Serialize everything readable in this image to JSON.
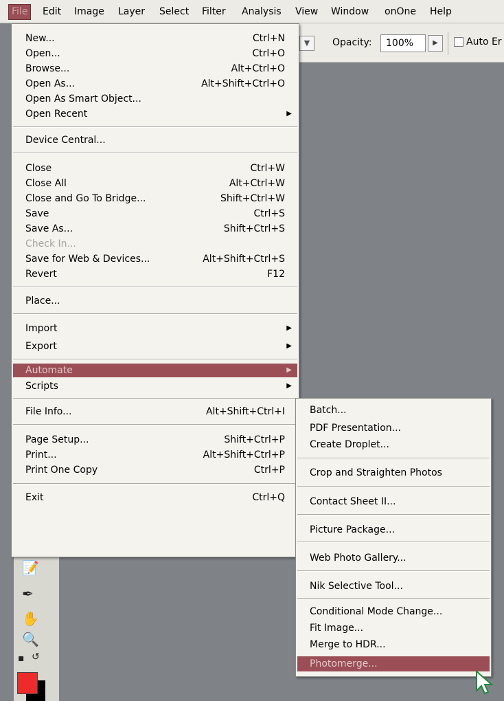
{
  "menubar": {
    "items": [
      {
        "label": "File",
        "active": true
      },
      {
        "label": "Edit"
      },
      {
        "label": "Image"
      },
      {
        "label": "Layer"
      },
      {
        "label": "Select"
      },
      {
        "label": "Filter"
      },
      {
        "label": "Analysis"
      },
      {
        "label": "View"
      },
      {
        "label": "Window"
      },
      {
        "label": "onOne"
      },
      {
        "label": "Help"
      }
    ]
  },
  "options_bar": {
    "opacity_label": "Opacity:",
    "opacity_value": "100%",
    "auto_label": "Auto Er"
  },
  "file_menu": {
    "items": [
      {
        "label": "New...",
        "shortcut": "Ctrl+N"
      },
      {
        "label": "Open...",
        "shortcut": "Ctrl+O"
      },
      {
        "label": "Browse...",
        "shortcut": "Alt+Ctrl+O"
      },
      {
        "label": "Open As...",
        "shortcut": "Alt+Shift+Ctrl+O"
      },
      {
        "label": "Open As Smart Object...",
        "shortcut": ""
      },
      {
        "label": "Open Recent",
        "shortcut": "",
        "submenu": true
      },
      {
        "label": "Device Central...",
        "shortcut": ""
      },
      {
        "label": "Close",
        "shortcut": "Ctrl+W"
      },
      {
        "label": "Close All",
        "shortcut": "Alt+Ctrl+W"
      },
      {
        "label": "Close and Go To Bridge...",
        "shortcut": "Shift+Ctrl+W"
      },
      {
        "label": "Save",
        "shortcut": "Ctrl+S"
      },
      {
        "label": "Save As...",
        "shortcut": "Shift+Ctrl+S"
      },
      {
        "label": "Check In...",
        "shortcut": "",
        "disabled": true
      },
      {
        "label": "Save for Web & Devices...",
        "shortcut": "Alt+Shift+Ctrl+S"
      },
      {
        "label": "Revert",
        "shortcut": "F12"
      },
      {
        "label": "Place...",
        "shortcut": ""
      },
      {
        "label": "Import",
        "shortcut": "",
        "submenu": true
      },
      {
        "label": "Export",
        "shortcut": "",
        "submenu": true
      },
      {
        "label": "Automate",
        "shortcut": "",
        "submenu": true,
        "highlighted": true
      },
      {
        "label": "Scripts",
        "shortcut": "",
        "submenu": true
      },
      {
        "label": "File Info...",
        "shortcut": "Alt+Shift+Ctrl+I"
      },
      {
        "label": "Page Setup...",
        "shortcut": "Shift+Ctrl+P"
      },
      {
        "label": "Print...",
        "shortcut": "Alt+Shift+Ctrl+P"
      },
      {
        "label": "Print One Copy",
        "shortcut": "Ctrl+P"
      },
      {
        "label": "Exit",
        "shortcut": "Ctrl+Q"
      }
    ]
  },
  "automate_menu": {
    "items": [
      {
        "label": "Batch..."
      },
      {
        "label": "PDF Presentation..."
      },
      {
        "label": "Create Droplet..."
      },
      {
        "label": "Crop and Straighten Photos"
      },
      {
        "label": "Contact Sheet II..."
      },
      {
        "label": "Picture Package..."
      },
      {
        "label": "Web Photo Gallery..."
      },
      {
        "label": "Nik Selective Tool..."
      },
      {
        "label": "Conditional Mode Change..."
      },
      {
        "label": "Fit Image..."
      },
      {
        "label": "Merge to HDR..."
      },
      {
        "label": "Photomerge...",
        "highlighted": true
      }
    ]
  },
  "colors": {
    "highlight": "#9b4e55",
    "foreground_swatch": "#ee2b2b",
    "background_swatch": "#000000",
    "workspace": "#7f8388"
  }
}
